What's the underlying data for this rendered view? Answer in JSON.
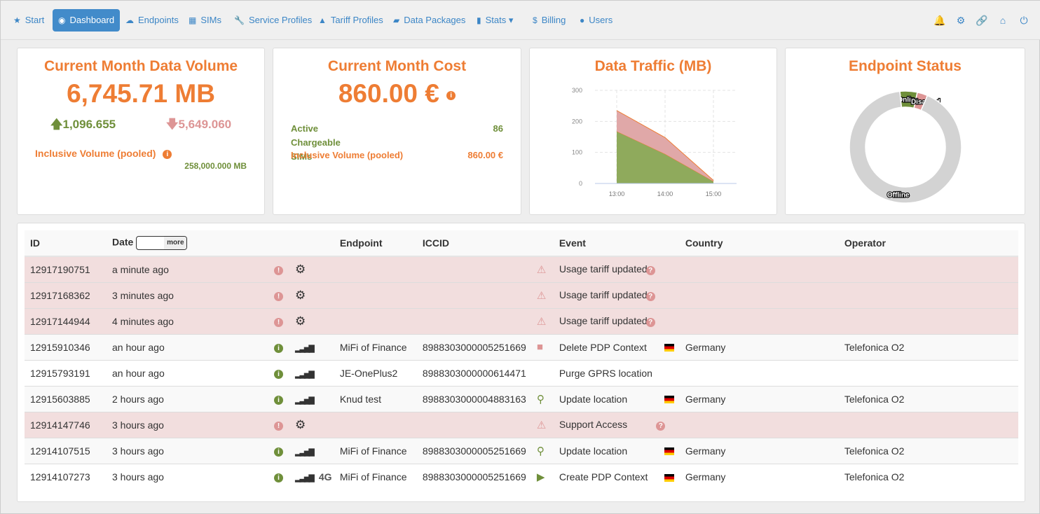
{
  "nav": {
    "items": [
      {
        "label": "Start",
        "icon": "star-icon",
        "glyph": "★"
      },
      {
        "label": "Dashboard",
        "icon": "dashboard-icon",
        "glyph": "◉",
        "active": true
      },
      {
        "label": "Endpoints",
        "icon": "cloud-icon",
        "glyph": "☁"
      },
      {
        "label": "SIMs",
        "icon": "grid-icon",
        "glyph": "▦"
      },
      {
        "label": "Service Profiles",
        "icon": "wrench-icon",
        "glyph": "🔧"
      },
      {
        "label": "Tariff Profiles",
        "icon": "road-icon",
        "glyph": "▲"
      },
      {
        "label": "Data Packages",
        "icon": "briefcase-icon",
        "glyph": "▰"
      },
      {
        "label": "Stats ▾",
        "icon": "bar-chart-icon",
        "glyph": "▮"
      },
      {
        "label": "Billing",
        "icon": "dollar-icon",
        "glyph": "$"
      },
      {
        "label": "Users",
        "icon": "user-icon",
        "glyph": "●"
      }
    ],
    "right": [
      {
        "icon": "bell-icon",
        "glyph": "🔔"
      },
      {
        "icon": "gear-icon",
        "glyph": "⚙"
      },
      {
        "icon": "link-icon",
        "glyph": "🔗"
      },
      {
        "icon": "home-icon",
        "glyph": "⌂"
      },
      {
        "icon": "power-icon",
        "glyph": "⏻"
      }
    ]
  },
  "volume": {
    "title": "Current Month Data Volume",
    "value": "6,745.71 MB",
    "up": "1,096.655",
    "down": "5,649.060",
    "inclusive_label": "Inclusive Volume (pooled)",
    "inclusive_value": "258,000.000 MB"
  },
  "cost": {
    "title": "Current Month Cost",
    "value": "860.00 €",
    "active_label": "Active Chargeable SIMs",
    "active_value": "86",
    "inclusive_label": "Inclusive Volume (pooled)",
    "inclusive_value": "860.00 €"
  },
  "chart_data": [
    {
      "type": "area",
      "title": "Data Traffic (MB)",
      "stacked": true,
      "x": [
        "13:00",
        "14:00",
        "15:00"
      ],
      "yticks": [
        0,
        100,
        200,
        300
      ],
      "ylim": [
        0,
        300
      ],
      "grid": true,
      "series": [
        {
          "values": [
            168,
            95,
            7
          ],
          "color": "#8faa5c"
        },
        {
          "values": [
            67,
            53,
            3
          ],
          "color": "#e0a8a8"
        }
      ]
    },
    {
      "type": "pie",
      "title": "Endpoint Status",
      "donut": true,
      "slices": [
        {
          "label": "Online",
          "value": 5,
          "color": "#6f8f3a"
        },
        {
          "label": "Disabled",
          "value": 3,
          "color": "#dd9595"
        },
        {
          "label": "Offline",
          "value": 92,
          "color": "#d3d3d3"
        }
      ]
    }
  ],
  "table": {
    "headers": {
      "id": "ID",
      "date": "Date",
      "more": "more",
      "endpoint": "Endpoint",
      "iccid": "ICCID",
      "event": "Event",
      "country": "Country",
      "operator": "Operator"
    },
    "rows": [
      {
        "id": "12917190751",
        "date": "a minute ago",
        "type": "alert",
        "endpoint": "",
        "iccid": "",
        "event_icon": "warning-icon",
        "event": "Usage tariff updated",
        "country": "",
        "operator": ""
      },
      {
        "id": "12917168362",
        "date": "3 minutes ago",
        "type": "alert",
        "endpoint": "",
        "iccid": "",
        "event_icon": "warning-icon",
        "event": "Usage tariff updated",
        "country": "",
        "operator": ""
      },
      {
        "id": "12917144944",
        "date": "4 minutes ago",
        "type": "alert",
        "endpoint": "",
        "iccid": "",
        "event_icon": "warning-icon",
        "event": "Usage tariff updated",
        "country": "",
        "operator": ""
      },
      {
        "id": "12915910346",
        "date": "an hour ago",
        "type": "info",
        "endpoint": "MiFi of Finance",
        "iccid": "8988303000005251669",
        "event_icon": "stop-icon",
        "event": "Delete PDP Context",
        "country": "Germany",
        "operator": "Telefonica O2"
      },
      {
        "id": "12915793191",
        "date": "an hour ago",
        "type": "info",
        "endpoint": "JE-OnePlus2",
        "iccid": "8988303000000614471",
        "event_icon": "",
        "event": "Purge GPRS location",
        "country": "",
        "operator": ""
      },
      {
        "id": "12915603885",
        "date": "2 hours ago",
        "type": "info",
        "endpoint": "Knud test",
        "iccid": "8988303000004883163",
        "event_icon": "map-marker-icon",
        "event": "Update location",
        "country": "Germany",
        "operator": "Telefonica O2"
      },
      {
        "id": "12914147746",
        "date": "3 hours ago",
        "type": "alert",
        "endpoint": "",
        "iccid": "",
        "event_icon": "warning-icon",
        "event": "Support Access",
        "country": "",
        "operator": ""
      },
      {
        "id": "12914107515",
        "date": "3 hours ago",
        "type": "info",
        "endpoint": "MiFi of Finance",
        "iccid": "8988303000005251669",
        "event_icon": "map-marker-icon",
        "event": "Update location",
        "country": "Germany",
        "operator": "Telefonica O2"
      },
      {
        "id": "12914107273",
        "date": "3 hours ago",
        "type": "info",
        "rat": "4G",
        "endpoint": "MiFi of Finance",
        "iccid": "8988303000005251669",
        "event_icon": "play-icon",
        "event": "Create PDP Context",
        "country": "Germany",
        "operator": "Telefonica O2"
      }
    ]
  }
}
